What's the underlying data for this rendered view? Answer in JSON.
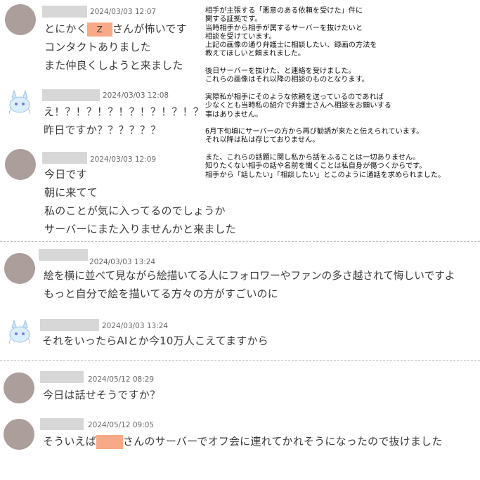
{
  "messages": [
    {
      "timestamp": "2024/03/03 12:07",
      "avatar": "gray",
      "lines": [
        {
          "before": "とにかく",
          "redacted": "Z",
          "after": "さんが怖いです"
        },
        {
          "text": "コンタクトありました"
        },
        {
          "text": "また仲良くしようと来ました"
        }
      ]
    },
    {
      "timestamp": "2024/03/03 12:08",
      "avatar": "mascot",
      "lines": [
        {
          "text": "え！？！？！？！？！？！？！？"
        },
        {
          "text": "昨日ですか？？？？？？"
        }
      ]
    },
    {
      "timestamp": "2024/03/03 12:09",
      "avatar": "gray",
      "lines": [
        {
          "text": "今日です"
        },
        {
          "text": "朝に来てて"
        },
        {
          "text": "私のことが気に入ってるのでしょうか"
        },
        {
          "text": "サーバーにまた入りませんかと来ました"
        }
      ]
    },
    {
      "timestamp": "2024/03/03 13:24",
      "avatar": "gray",
      "lines": [
        {
          "text": "絵を横に並べて見ながら絵描いてる人にフォロワーやファンの多さ越されて悔しいですよ"
        },
        {
          "text": "もっと自分で絵を描いてる方々の方がすごいのに"
        }
      ]
    },
    {
      "timestamp": "2024/03/03 13:24",
      "avatar": "mascot",
      "lines": [
        {
          "text": "それをいったらAIとか今10万人こえてますから"
        }
      ]
    },
    {
      "timestamp": "2024/05/12 08:29",
      "avatar": "gray",
      "lines": [
        {
          "text": "今日は話せそうですか？"
        }
      ]
    },
    {
      "timestamp": "2024/05/12 09:05",
      "avatar": "gray",
      "lines": [
        {
          "before": "そういえば",
          "redacted": "",
          "after": "さんのサーバーでオフ会に連れてかれそうになったので抜けました"
        }
      ]
    }
  ],
  "note": {
    "lines": [
      "相手が主張する「悪意のある依頼を受けた」件に",
      "関する証拠です。",
      "当時相手から相手が属するサーバーを抜けたいと",
      "相談を受けています。",
      "上記の画像の通り弁護士に相談したい、録画の方法を",
      "教えてほしいと頼まれました。",
      "",
      "後日サーバーを抜けた、と連絡を受けました。",
      "これらの画像はそれ以降の相談のものとなります。",
      "",
      "実際私が相手にそのような依頼を送っているのであれば",
      "少なくとも当時私の紹介で弁護士さんへ相談をお願いする",
      "事はありません。",
      "",
      "6月下旬頃にサーバーの方から再び勧誘が来たと伝えられています。",
      "それ以降は私は存じておりません。",
      "",
      "また、これらの話題に関し私から話をふることは一切ありません。",
      "知りたくない相手の話や名前を聞くことは私自身が傷つくからです。",
      "相手から「話したい」「相談したい」とこのように通話を求められました。"
    ]
  },
  "colors": {
    "avatar_gray": "#ab9e9b",
    "name_redaction": "#d7d7d7",
    "inline_redaction": "#f7a988",
    "mascot_body": "#cfe6f7",
    "mascot_accent": "#7a78d9"
  }
}
